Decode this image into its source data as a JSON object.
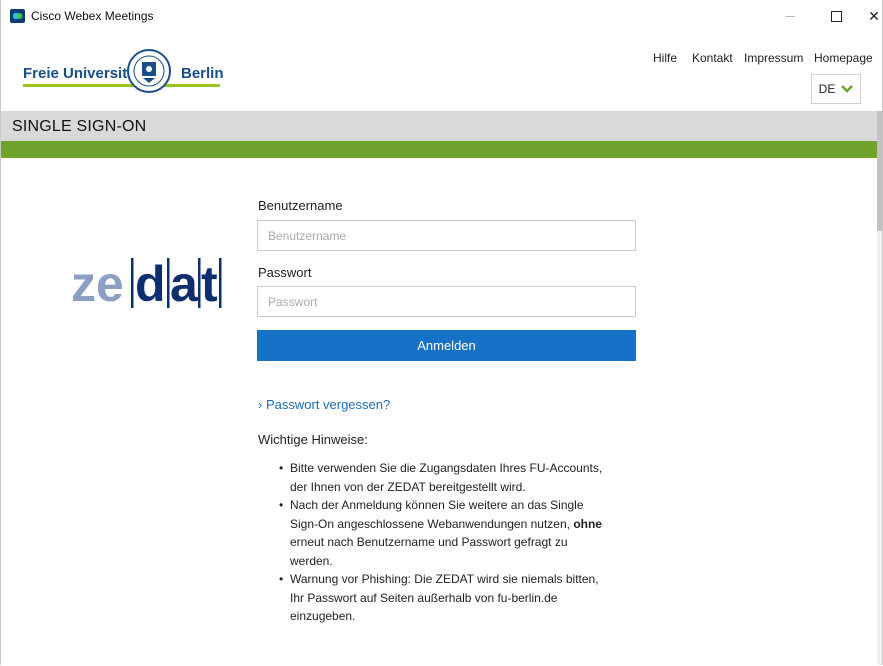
{
  "window": {
    "title": "Cisco Webex Meetings",
    "controls": {
      "minimize": "—",
      "maximize": "☐",
      "close": "✕"
    }
  },
  "header": {
    "logo": {
      "left_text": "Freie Universität",
      "right_text": "Berlin"
    },
    "nav": [
      {
        "label": "Hilfe"
      },
      {
        "label": "Kontakt"
      },
      {
        "label": "Impressum"
      },
      {
        "label": "Homepage"
      }
    ],
    "language": {
      "selected": "DE"
    }
  },
  "sso": {
    "title": "SINGLE SIGN-ON"
  },
  "login": {
    "username_label": "Benutzername",
    "username_placeholder": "Benutzername",
    "username_value": "",
    "password_label": "Passwort",
    "password_placeholder": "Passwort",
    "password_value": "",
    "submit_label": "Anmelden",
    "forgot_link": "› Passwort vergessen?"
  },
  "notes": {
    "title": "Wichtige Hinweise:",
    "items": [
      {
        "text": "Bitte verwenden Sie die Zugangsdaten Ihres FU-Accounts, der Ihnen von der ZEDAT bereitgestellt wird."
      },
      {
        "pre": "Nach der Anmeldung können Sie weitere an das Single Sign-On angeschlossene Webanwendungen nutzen, ",
        "bold": "ohne",
        "post": " erneut nach Benutzername und Passwort gefragt zu werden."
      },
      {
        "text": "Warnung vor Phishing: Die ZEDAT wird sie niemals bitten, Ihr Passwort auf Seiten außerhalb von fu-berlin.de einzugeben."
      }
    ]
  },
  "brand": {
    "zedat_logo": "zedat",
    "colors": {
      "green": "#6ea22b",
      "blue_button": "#1572c7",
      "link": "#1a6fb8",
      "fu_blue": "#1a4e8a",
      "fu_green": "#9ac31c"
    }
  },
  "icons": {
    "app": "webex-icon",
    "seal": "university-seal-icon",
    "dropdown": "chevron-down-icon"
  }
}
